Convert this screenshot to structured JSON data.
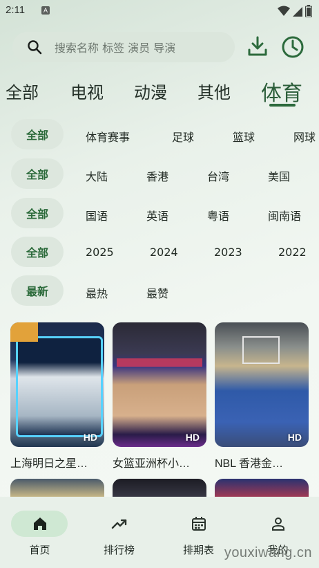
{
  "status_bar": {
    "time": "2:11",
    "notification_glyph": "A"
  },
  "search": {
    "placeholder": "搜索名称 标签 演员 导演"
  },
  "categories": [
    {
      "label": "全部",
      "active": false
    },
    {
      "label": "电视",
      "active": false
    },
    {
      "label": "动漫",
      "active": false
    },
    {
      "label": "其他",
      "active": false
    },
    {
      "label": "体育",
      "active": true
    }
  ],
  "filters": {
    "type": {
      "selected": "全部",
      "options": [
        "体育赛事",
        "足球",
        "篮球",
        "网球"
      ]
    },
    "region": {
      "selected": "全部",
      "options": [
        "大陆",
        "香港",
        "台湾",
        "美国"
      ]
    },
    "language": {
      "selected": "全部",
      "options": [
        "国语",
        "英语",
        "粤语",
        "闽南语"
      ]
    },
    "year": {
      "selected": "全部",
      "options": [
        "2025",
        "2024",
        "2023",
        "2022"
      ]
    },
    "sort": {
      "selected": "最新",
      "options": [
        "最热",
        "最赞"
      ]
    }
  },
  "cards": [
    {
      "title": "上海明日之星…",
      "badge": "HD"
    },
    {
      "title": "女篮亚洲杯小…",
      "badge": "HD"
    },
    {
      "title": "NBL 香港金…",
      "badge": "HD"
    }
  ],
  "bottom_nav": [
    {
      "label": "首页",
      "icon": "home-icon",
      "active": true
    },
    {
      "label": "排行榜",
      "icon": "trending-icon",
      "active": false
    },
    {
      "label": "排期表",
      "icon": "calendar-icon",
      "active": false
    },
    {
      "label": "我的",
      "icon": "person-icon",
      "active": false
    }
  ],
  "watermark": "youxiwang.cn",
  "colors": {
    "accent": "#2c6a3c",
    "chip_bg": "#dde7de",
    "nav_active": "#cfe8d3"
  }
}
